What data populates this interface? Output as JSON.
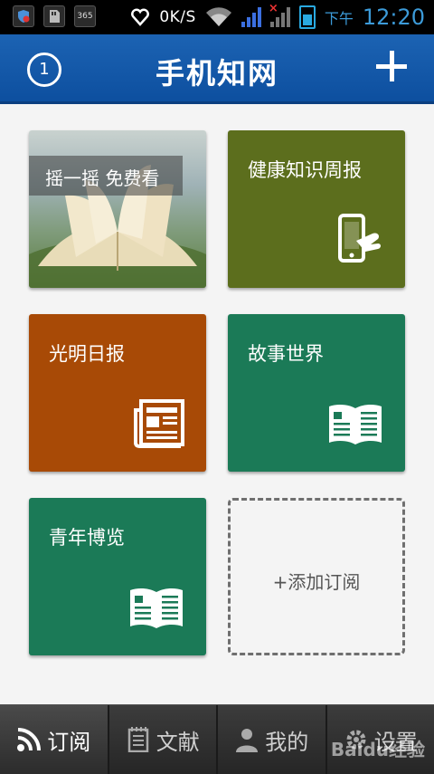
{
  "status_bar": {
    "net_speed": "0K/S",
    "am_pm": "下午",
    "time": "12:20",
    "app_chip": "365",
    "colors": {
      "time": "#3c9bd9",
      "signal": "#3b6fe0"
    }
  },
  "header": {
    "badge_count": "1",
    "title": "手机知网",
    "bg_color": "#1c63b3"
  },
  "tiles": [
    {
      "label": "摇一摇 免费看",
      "color": "#7f9b7a",
      "icon": "open-book-photo"
    },
    {
      "label": "健康知识周报",
      "color": "#5c6e1d",
      "icon": "phone-hand-icon"
    },
    {
      "label": "光明日报",
      "color": "#a84a06",
      "icon": "newspaper-icon"
    },
    {
      "label": "故事世界",
      "color": "#1b7a57",
      "icon": "open-book-icon"
    },
    {
      "label": "青年博览",
      "color": "#1b7a57",
      "icon": "open-book-icon"
    }
  ],
  "add_tile": {
    "label": "+添加订阅"
  },
  "bottom_nav": [
    {
      "label": "订阅",
      "icon": "rss-icon",
      "active": true
    },
    {
      "label": "文献",
      "icon": "document-icon",
      "active": false
    },
    {
      "label": "我的",
      "icon": "user-icon",
      "active": false
    },
    {
      "label": "设置",
      "icon": "gear-icon",
      "active": false
    }
  ],
  "watermark": "Baidu经验"
}
